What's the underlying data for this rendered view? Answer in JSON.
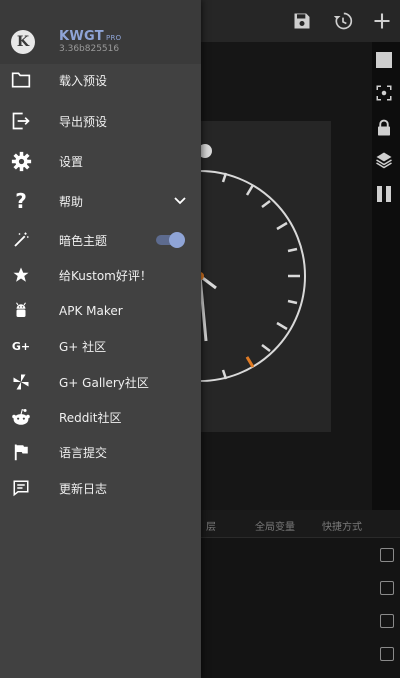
{
  "app": {
    "name": "KWGT",
    "edition": "PRO",
    "version": "3.36b825516"
  },
  "menu": [
    {
      "label": "载入预设",
      "icon": "folder-icon"
    },
    {
      "label": "导出预设",
      "icon": "export-icon"
    },
    {
      "label": "设置",
      "icon": "gear-icon"
    },
    {
      "label": "帮助",
      "icon": "help-icon"
    },
    {
      "label": "暗色主题",
      "icon": "magic-wand-icon",
      "toggle_on": true
    },
    {
      "label": "给Kustom好评！",
      "icon": "star-icon"
    },
    {
      "label": "APK Maker",
      "icon": "android-icon"
    },
    {
      "label": "G+ 社区",
      "icon": "google-plus-icon"
    },
    {
      "label": "G+ Gallery社区",
      "icon": "pinwheel-icon"
    },
    {
      "label": "Reddit社区",
      "icon": "reddit-icon"
    },
    {
      "label": "语言提交",
      "icon": "flag-icon"
    },
    {
      "label": "更新日志",
      "icon": "changelog-icon"
    }
  ],
  "background": {
    "tabs": [
      "层",
      "全局变量",
      "快捷方式"
    ]
  },
  "colors": {
    "accent": "#8fa4d6",
    "drawer": "#414141",
    "clock_hand_accent": "#e07a22"
  }
}
